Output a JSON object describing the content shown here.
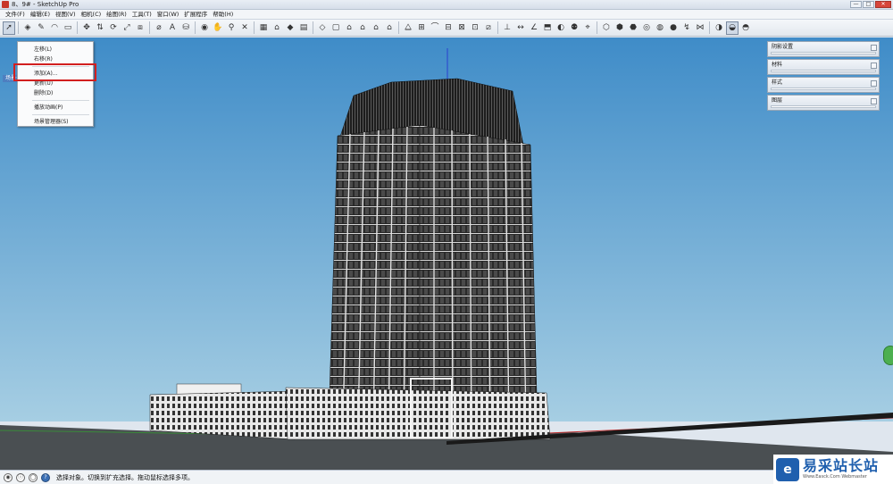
{
  "window": {
    "title": "8、9# - SketchUp Pro",
    "minimize": "—",
    "maximize": "□",
    "close": "✕"
  },
  "menu": [
    "文件(F)",
    "编辑(E)",
    "视图(V)",
    "相机(C)",
    "绘图(R)",
    "工具(T)",
    "窗口(W)",
    "扩展程序",
    "帮助(H)"
  ],
  "scene_tab": "场景号1",
  "context_menu": {
    "items": [
      "左移(L)",
      "右移(R)",
      "添加(A)...",
      "更新(U)",
      "删除(D)",
      "播放动画(P)",
      "场景管理器(S)"
    ],
    "highlighted": "添加(A)..."
  },
  "trays": [
    "阴影设置",
    "材料",
    "样式",
    "图层"
  ],
  "statusbar": {
    "hint": "选择对象。切换到扩充选择。拖动鼠标选择多项。"
  },
  "watermark": {
    "logo": "e",
    "text": "易采站长站",
    "sub": "Www.Easck.Com  Webmaster"
  },
  "colors": {
    "sky_top": "#3f8cc8",
    "sky_bottom": "#a6cee3",
    "ground": "#4a4f52",
    "building": "#2d2d2d",
    "highlight": "#d21f1f",
    "accent": "#4e7fc0"
  }
}
